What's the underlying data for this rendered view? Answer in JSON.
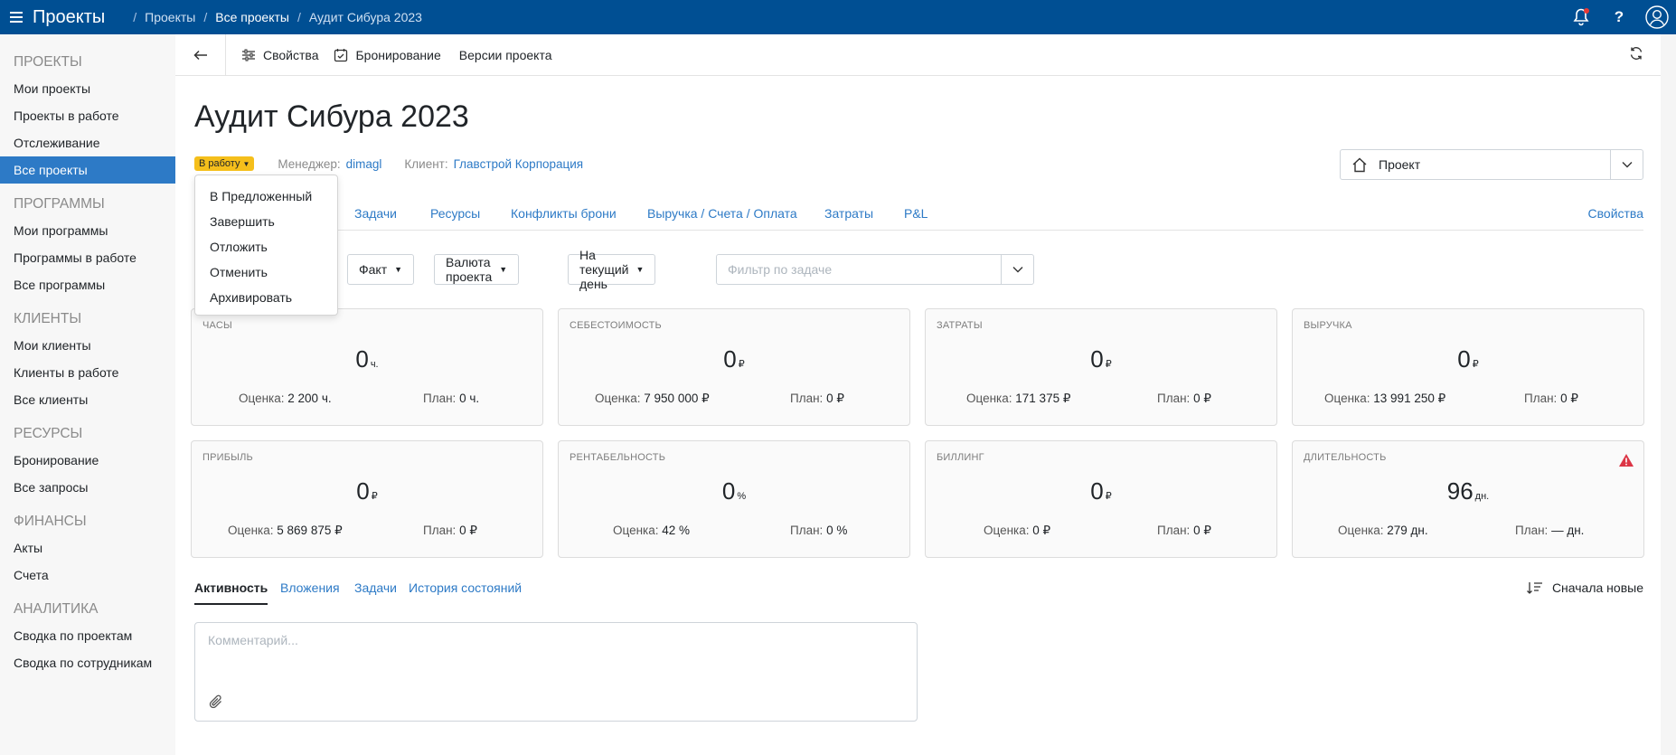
{
  "topbar": {
    "app_title": "Проекты",
    "breadcrumbs": [
      "Проекты",
      "Все проекты",
      "Аудит Сибура 2023"
    ]
  },
  "sidebar": {
    "sections": [
      {
        "title": "ПРОЕКТЫ",
        "items": [
          "Мои проекты",
          "Проекты в работе",
          "Отслеживание",
          "Все проекты"
        ]
      },
      {
        "title": "ПРОГРАММЫ",
        "items": [
          "Мои программы",
          "Программы в работе",
          "Все программы"
        ]
      },
      {
        "title": "КЛИЕНТЫ",
        "items": [
          "Мои клиенты",
          "Клиенты в работе",
          "Все клиенты"
        ]
      },
      {
        "title": "РЕСУРСЫ",
        "items": [
          "Бронирование",
          "Все запросы"
        ]
      },
      {
        "title": "ФИНАНСЫ",
        "items": [
          "Акты",
          "Счета"
        ]
      },
      {
        "title": "АНАЛИТИКА",
        "items": [
          "Сводка по проектам",
          "Сводка по сотрудникам"
        ]
      }
    ],
    "active_item": "Все проекты"
  },
  "toolbar": {
    "properties": "Свойства",
    "booking": "Бронирование",
    "versions": "Версии проекта"
  },
  "project": {
    "title": "Аудит Сибура 2023",
    "status": "В работу",
    "manager_label": "Менеджер:",
    "manager": "dimagl",
    "client_label": "Клиент:",
    "client": "Главстрой Корпорация",
    "type_select": "Проект"
  },
  "tabs": [
    "Задачи",
    "Ресурсы",
    "Конфликты брони",
    "Выручка / Счета / Оплата",
    "Затраты",
    "P&L"
  ],
  "tabs_right": "Свойства",
  "filters": {
    "fact": "Факт",
    "currency": "Валюта проекта",
    "date": "На текущий день",
    "task_placeholder": "Фильтр по задаче"
  },
  "cards": [
    {
      "caption": "ЧАСЫ",
      "value": "0",
      "unit": "ч.",
      "est_label": "Оценка:",
      "est": "2 200 ч.",
      "plan_label": "План:",
      "plan": "0 ч."
    },
    {
      "caption": "СЕБЕСТОИМОСТЬ",
      "value": "0",
      "unit": "₽",
      "est_label": "Оценка:",
      "est": "7 950 000 ₽",
      "plan_label": "План:",
      "plan": "0 ₽"
    },
    {
      "caption": "ЗАТРАТЫ",
      "value": "0",
      "unit": "₽",
      "est_label": "Оценка:",
      "est": "171 375 ₽",
      "plan_label": "План:",
      "plan": "0 ₽"
    },
    {
      "caption": "ВЫРУЧКА",
      "value": "0",
      "unit": "₽",
      "est_label": "Оценка:",
      "est": "13 991 250 ₽",
      "plan_label": "План:",
      "plan": "0 ₽"
    },
    {
      "caption": "ПРИБЫЛЬ",
      "value": "0",
      "unit": "₽",
      "est_label": "Оценка:",
      "est": "5 869 875 ₽",
      "plan_label": "План:",
      "plan": "0 ₽"
    },
    {
      "caption": "РЕНТАБЕЛЬНОСТЬ",
      "value": "0",
      "unit": "%",
      "est_label": "Оценка:",
      "est": "42 %",
      "plan_label": "План:",
      "plan": "0 %"
    },
    {
      "caption": "БИЛЛИНГ",
      "value": "0",
      "unit": "₽",
      "est_label": "Оценка:",
      "est": "0 ₽",
      "plan_label": "План:",
      "plan": "0 ₽"
    },
    {
      "caption": "ДЛИТЕЛЬНОСТЬ",
      "value": "96",
      "unit": "дн.",
      "est_label": "Оценка:",
      "est": "279 дн.",
      "plan_label": "План:",
      "plan": "— дн."
    }
  ],
  "activity": {
    "tabs": [
      "Активность",
      "Вложения",
      "Задачи",
      "История состояний"
    ],
    "sort": "Сначала новые",
    "comment_placeholder": "Комментарий..."
  },
  "status_menu": [
    "В Предложенный",
    "Завершить",
    "Отложить",
    "Отменить",
    "Архивировать"
  ],
  "colors": {
    "topbar": "#004f93",
    "accent": "#2d7ac6",
    "status_badge": "#f5bf1b",
    "warning": "#dc3545"
  }
}
